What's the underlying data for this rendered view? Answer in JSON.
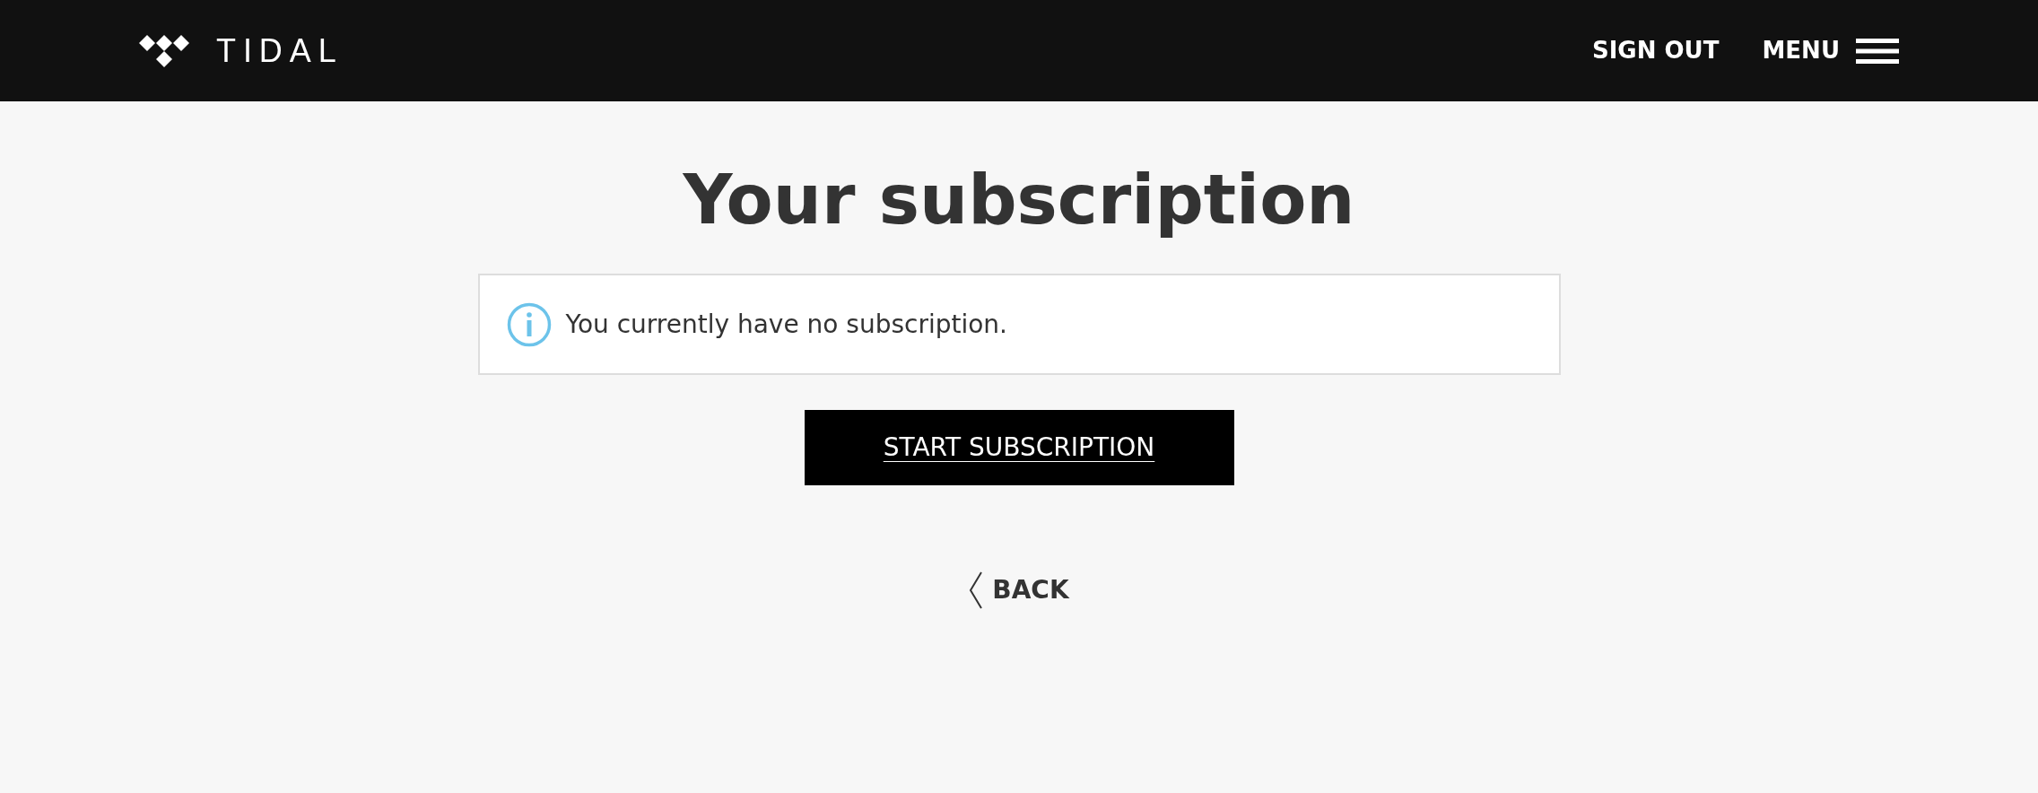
{
  "header": {
    "brand": "TIDAL",
    "links": [
      {
        "label": "SIGN OUT",
        "kind": "link"
      },
      {
        "label": "MENU",
        "kind": "menu"
      }
    ]
  },
  "title": "Your subscription",
  "notice": {
    "text": "You currently have no subscription."
  },
  "primary_button": "START SUBSCRIPTION",
  "back_link": "BACK"
}
